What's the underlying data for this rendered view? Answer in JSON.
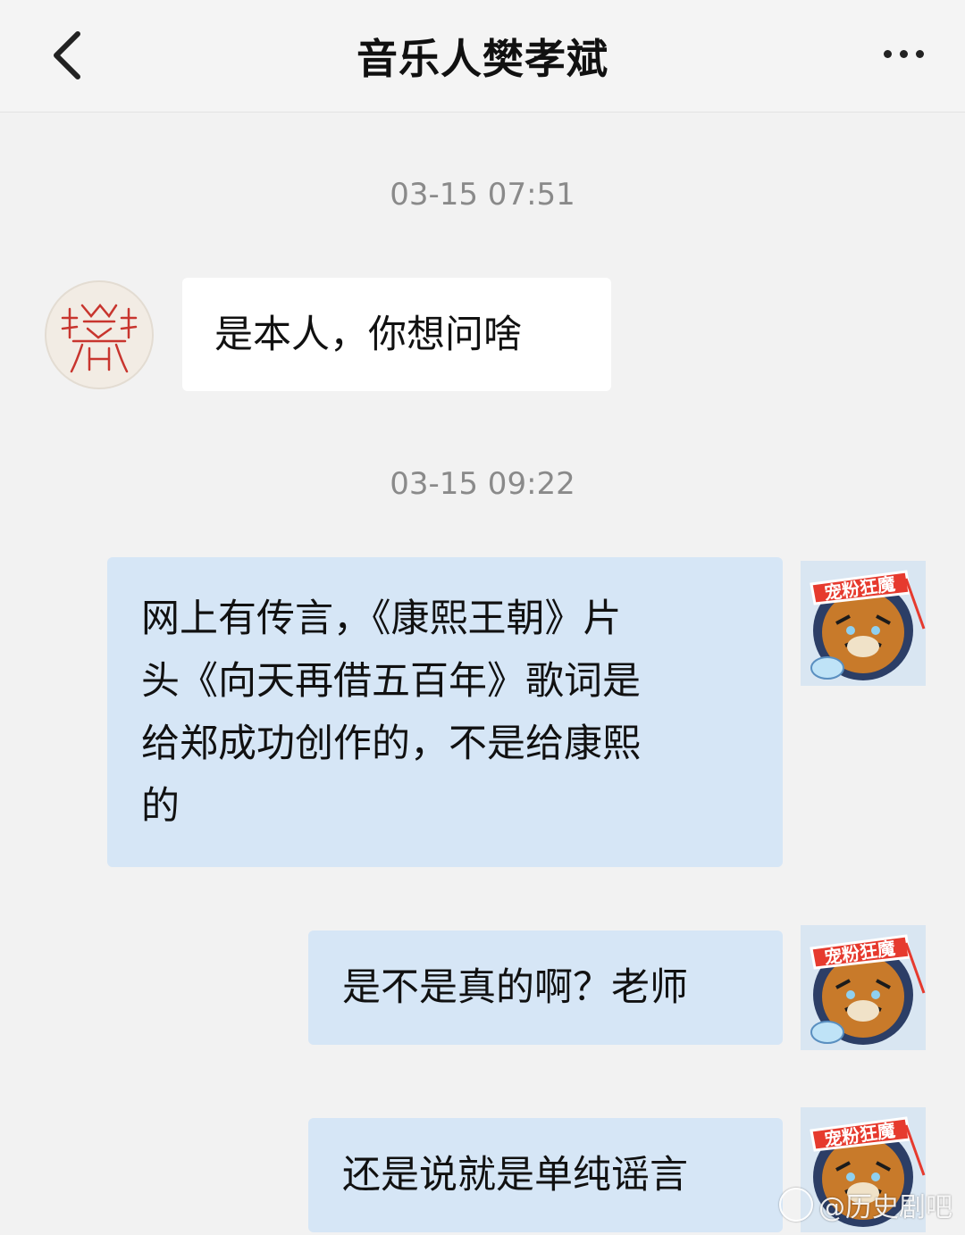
{
  "header": {
    "title": "音乐人樊孝斌",
    "back_icon": "chevron-left-icon",
    "more_icon": "more-horizontal-icon"
  },
  "messages": [
    {
      "type": "timestamp",
      "text": "03-15 07:51"
    },
    {
      "type": "incoming",
      "text": "是本人，你想问啥",
      "avatar": "seal-avatar"
    },
    {
      "type": "timestamp",
      "text": "03-15 09:22"
    },
    {
      "type": "outgoing",
      "lines": [
        "网上有传言，《康熙王朝》片",
        "头《向天再借五百年》歌词是",
        "给郑成功创作的，不是给康熙",
        "的"
      ],
      "avatar": "tiger-avatar"
    },
    {
      "type": "outgoing",
      "text": "是不是真的啊？老师",
      "avatar": "tiger-avatar"
    },
    {
      "type": "outgoing",
      "text": "还是说就是单纯谣言",
      "avatar": "tiger-avatar"
    }
  ],
  "badge": {
    "text": "宠粉狂魔"
  },
  "watermark": {
    "text": "@历史剧吧"
  },
  "colors": {
    "background": "#f2f2f2",
    "incoming_bubble": "#ffffff",
    "outgoing_bubble": "#d6e6f6",
    "timestamp": "#8a8a8a",
    "seal_red": "#c8352e"
  }
}
